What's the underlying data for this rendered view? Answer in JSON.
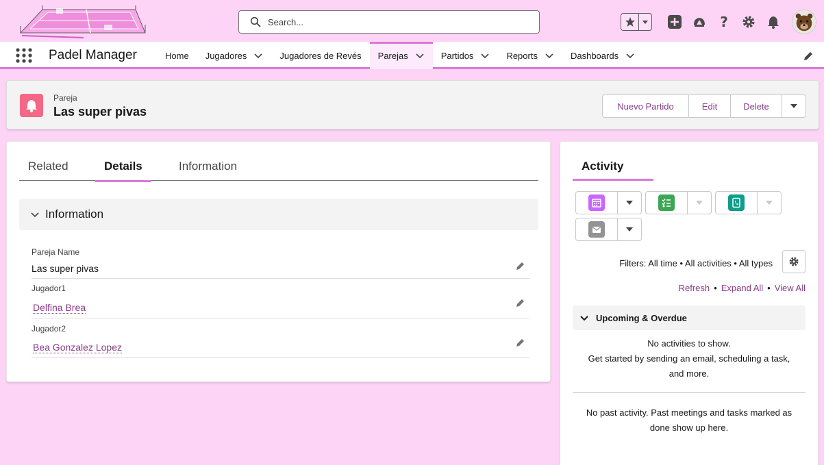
{
  "header": {
    "search_placeholder": "Search...",
    "icons": [
      "favorites-star-icon",
      "add-icon",
      "trailhead-icon",
      "help-icon",
      "setup-gear-icon",
      "notifications-bell-icon",
      "user-avatar"
    ]
  },
  "nav": {
    "app_name": "Padel Manager",
    "items": [
      {
        "label": "Home",
        "has_menu": false
      },
      {
        "label": "Jugadores",
        "has_menu": true
      },
      {
        "label": "Jugadores de Revés",
        "has_menu": false
      },
      {
        "label": "Parejas",
        "has_menu": true,
        "active": true
      },
      {
        "label": "Partidos",
        "has_menu": true
      },
      {
        "label": "Reports",
        "has_menu": true
      },
      {
        "label": "Dashboards",
        "has_menu": true
      }
    ]
  },
  "record": {
    "object_type": "Pareja",
    "title": "Las super pivas",
    "actions": [
      "Nuevo Partido",
      "Edit",
      "Delete"
    ]
  },
  "details": {
    "tabs": [
      "Related",
      "Details",
      "Information"
    ],
    "active_tab": "Details",
    "section_title": "Information",
    "fields": [
      {
        "label": "Pareja Name",
        "value": "Las super pivas",
        "link": false
      },
      {
        "label": "Jugador1",
        "value": "Delfina Brea",
        "link": true
      },
      {
        "label": "Jugador2",
        "value": "Bea Gonzalez Lopez",
        "link": true
      }
    ]
  },
  "activity": {
    "tab": "Activity",
    "filters": "Filters: All time • All activities • All types",
    "links": [
      "Refresh",
      "Expand All",
      "View All"
    ],
    "upcoming_title": "Upcoming & Overdue",
    "upcoming_empty_1": "No activities to show.",
    "upcoming_empty_2": "Get started by sending an email, scheduling a task,",
    "upcoming_empty_3": "and more.",
    "past_empty_1": "No past activity. Past meetings and tasks marked as",
    "past_empty_2": "done show up here."
  },
  "colors": {
    "background": "#fdd3f6",
    "accent": "#d97ad8",
    "link": "#8a3c8b",
    "record_icon": "#f36886",
    "event_icon": "#cb65ff",
    "task_icon": "#3ba755",
    "call_icon": "#0d9d8a",
    "email_icon": "#939393"
  }
}
